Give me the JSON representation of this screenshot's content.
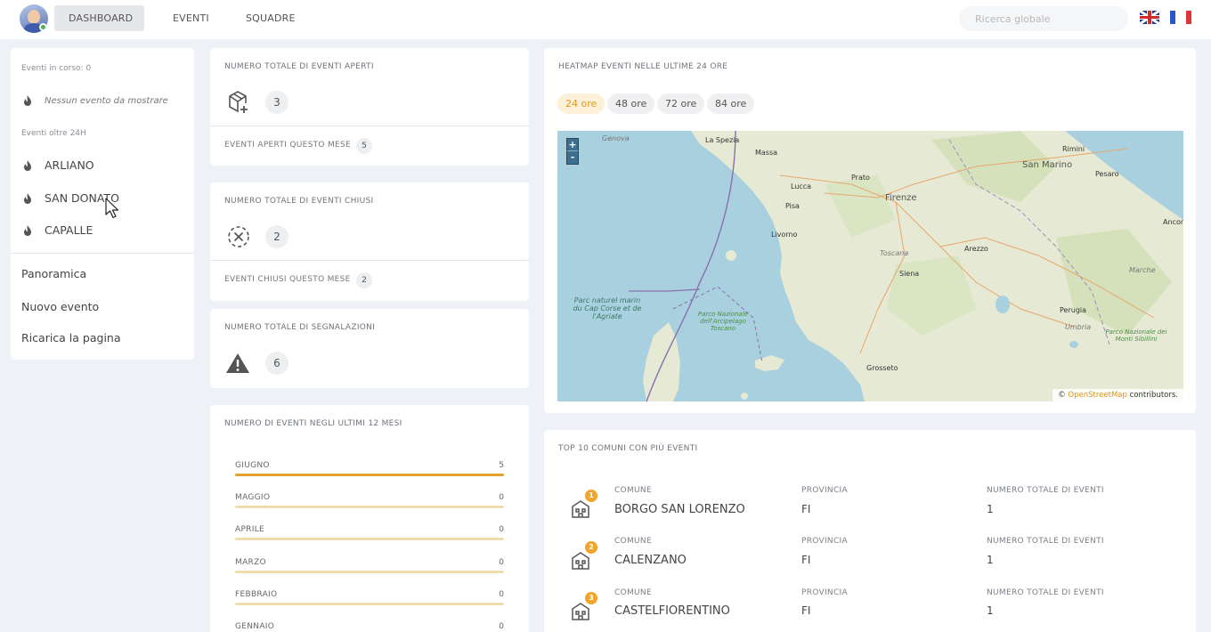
{
  "topbar": {
    "nav": [
      "DASHBOARD",
      "EVENTI",
      "SQUADRE"
    ],
    "search_placeholder": "Ricerca globale",
    "flags": [
      "uk-flag",
      "fr-flag"
    ]
  },
  "sidebar": {
    "ongoing_label": "Eventi in corso: 0",
    "ongoing_empty": "Nessun evento da mostrare",
    "over24_label": "Eventi oltre 24H",
    "over24_items": [
      "ARLIANO",
      "SAN DONATO",
      "CAPALLE"
    ],
    "links": [
      "Panoramica",
      "Nuovo evento",
      "Ricarica la pagina"
    ]
  },
  "stats": {
    "open": {
      "title": "NUMERO TOTALE DI EVENTI APERTI",
      "value": "3",
      "foot_label": "EVENTI APERTI QUESTO MESE",
      "foot_value": "5"
    },
    "closed": {
      "title": "NUMERO TOTALE DI EVENTI CHIUSI",
      "value": "2",
      "foot_label": "EVENTI CHIUSI QUESTO MESE",
      "foot_value": "2"
    },
    "reports": {
      "title": "NUMERO TOTALE DI SEGNALAZIONI",
      "value": "6"
    }
  },
  "monthly": {
    "title": "NUMERO DI EVENTI NEGLI ULTIMI 12 MESI",
    "rows": [
      {
        "month": "GIUGNO",
        "value": "5"
      },
      {
        "month": "MAGGIO",
        "value": "0"
      },
      {
        "month": "APRILE",
        "value": "0"
      },
      {
        "month": "MARZO",
        "value": "0"
      },
      {
        "month": "FEBBRAIO",
        "value": "0"
      },
      {
        "month": "GENNAIO",
        "value": "0"
      }
    ]
  },
  "heatmap": {
    "title": "HEATMAP EVENTI NELLE ULTIME 24 ORE",
    "pills": [
      "24 ore",
      "48 ore",
      "72 ore",
      "84 ore"
    ],
    "active_pill": "24 ore",
    "zoom_in": "+",
    "zoom_out": "-",
    "attribution_link": "OpenStreetMap",
    "attribution_prefix": "©",
    "attribution_suffix": "contributors.",
    "labels": {
      "genova": "Genova",
      "laspezia": "La Spezia",
      "massa": "Massa",
      "lucca": "Lucca",
      "prato": "Prato",
      "firenze": "Firenze",
      "pisa": "Pisa",
      "livorno": "Livorno",
      "toscana": "Toscana",
      "arezzo": "Arezzo",
      "siena": "Siena",
      "perugia": "Perugia",
      "umbria": "Umbria",
      "grosseto": "Grosseto",
      "sanmarino": "San Marino",
      "rimini": "Rimini",
      "pesaro": "Pesaro",
      "ancona": "Ancon",
      "marche": "Marche",
      "parc_naturel": "Parc naturel marin du Cap Corse et de l'Agriate",
      "parco_nazionale": "Parco Nazionale dell'Arcipelago Toscano",
      "parco_sibillini": "Parco Nazionale dei Monti Sibillini"
    }
  },
  "top10": {
    "title": "TOP 10 COMUNI CON PIÙ EVENTI",
    "headers": {
      "comune": "COMUNE",
      "provincia": "PROVINCIA",
      "totale": "NUMERO TOTALE DI EVENTI"
    },
    "rows": [
      {
        "rank": "1",
        "comune": "BORGO SAN LORENZO",
        "provincia": "FI",
        "totale": "1"
      },
      {
        "rank": "2",
        "comune": "CALENZANO",
        "provincia": "FI",
        "totale": "1"
      },
      {
        "rank": "3",
        "comune": "CASTELFIORENTINO",
        "provincia": "FI",
        "totale": "1"
      }
    ]
  },
  "colors": {
    "accent": "#e3a32a",
    "pill_active_bg": "#fdf0d8",
    "sea": "#a9d0de",
    "land": "#e9ecd9"
  }
}
